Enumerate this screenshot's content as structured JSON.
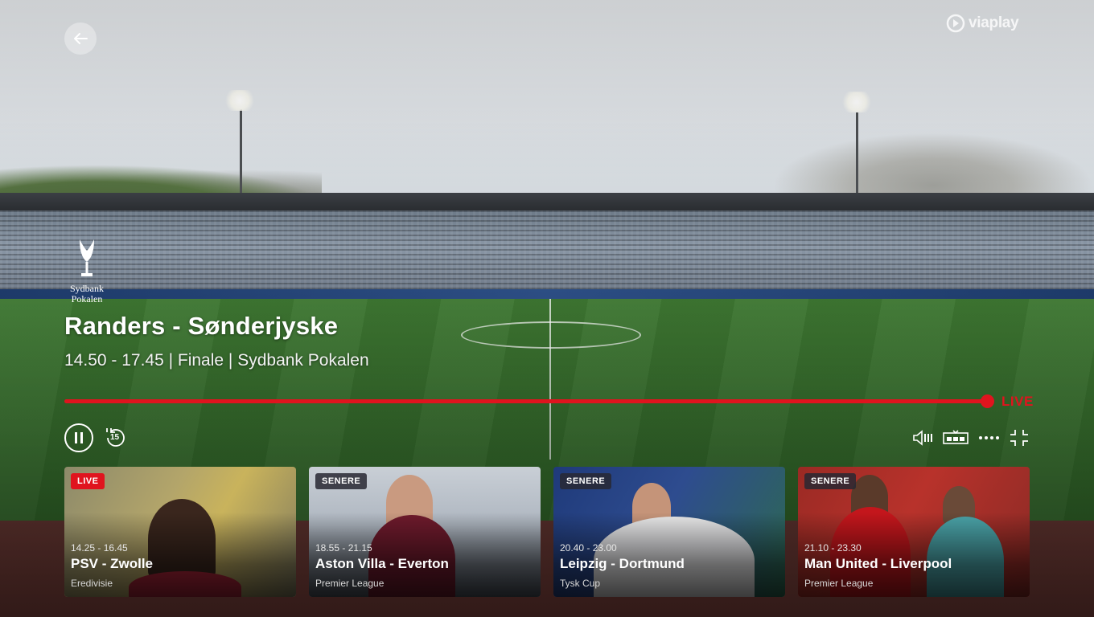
{
  "brand": {
    "name": "viaplay"
  },
  "league_logo": {
    "line1": "Sydbank",
    "line2": "Pokalen"
  },
  "event": {
    "title": "Randers - Sønderjyske",
    "meta": "14.50 - 17.45 | Finale | Sydbank Pokalen"
  },
  "player": {
    "live_label": "LIVE",
    "progress": 1.0,
    "rewind_seconds": "15",
    "icons": [
      "back-arrow-icon",
      "pause-icon",
      "rewind-15-icon",
      "audio-subtitles-icon",
      "picture-in-picture-icon",
      "more-icon",
      "exit-fullscreen-icon"
    ]
  },
  "colors": {
    "accent": "#e0141e"
  },
  "cards": [
    {
      "badge": "LIVE",
      "time": "14.25 - 16.45",
      "name": "PSV - Zwolle",
      "league": "Eredivisie"
    },
    {
      "badge": "SENERE",
      "time": "18.55 - 21.15",
      "name": "Aston Villa - Everton",
      "league": "Premier League"
    },
    {
      "badge": "SENERE",
      "time": "20.40 - 23.00",
      "name": "Leipzig - Dortmund",
      "league": "Tysk Cup"
    },
    {
      "badge": "SENERE",
      "time": "21.10 - 23.30",
      "name": "Man United - Liverpool",
      "league": "Premier League"
    }
  ]
}
